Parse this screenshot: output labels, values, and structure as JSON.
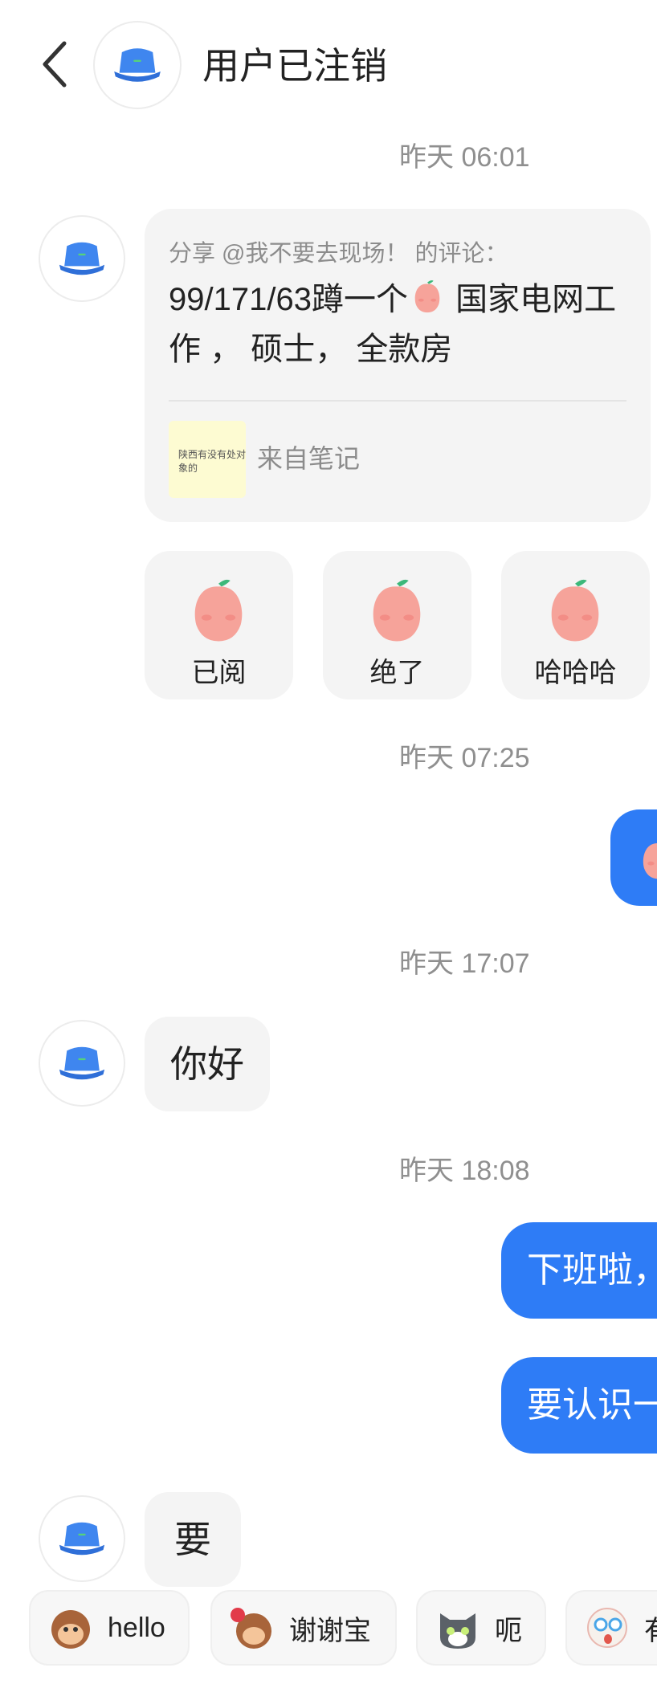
{
  "header": {
    "back_icon": "chevron-left-icon",
    "avatar_icon": "bucket-hat-icon",
    "title": "用户已注销"
  },
  "colors": {
    "accent_blue": "#2e7cf6",
    "bubble_gray": "#f4f4f4",
    "timestamp_gray": "#8f8f8f"
  },
  "messages": {
    "ts1": "昨天 06:01",
    "share": {
      "header": "分享 @我不要去现场！ 的评论：",
      "body_part1": "99/171/63蹲一个",
      "body_part2": " 国家电网工作 ， 硕士， 全款房",
      "note_thumb_text": "陕西有没有处对象的",
      "note_source": "来自笔记"
    },
    "stickers": [
      {
        "label": "已阅",
        "icon": "peach-tea-sticker-icon"
      },
      {
        "label": "绝了",
        "icon": "peach-thumbs-up-sticker-icon"
      },
      {
        "label": "哈哈哈",
        "icon": "peach-laughing-sticker-icon"
      }
    ],
    "ts2": "昨天 07:25",
    "ts3": "昨天 17:07",
    "greeting": "你好",
    "ts4": "昨天 18:08",
    "reply1": "下班啦，",
    "reply2": "要认识一",
    "last": "要"
  },
  "quick_replies": [
    {
      "label": "hello",
      "icon": "monkey-wave-icon"
    },
    {
      "label": "谢谢宝",
      "icon": "monkey-rose-icon"
    },
    {
      "label": "呃",
      "icon": "cat-awkward-icon"
    },
    {
      "label": "有",
      "icon": "surprised-face-icon"
    }
  ]
}
